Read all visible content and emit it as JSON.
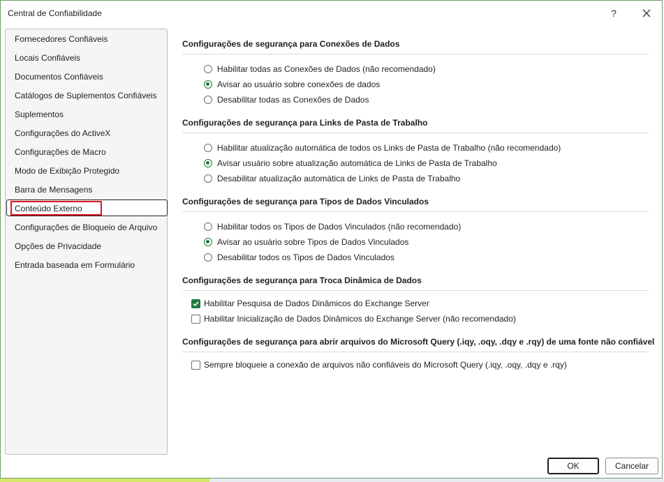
{
  "window": {
    "title": "Central de Confiabilidade",
    "help_glyph": "?",
    "close_icon": "close-icon"
  },
  "sidebar": {
    "items": [
      {
        "label": "Fornecedores Confiáveis"
      },
      {
        "label": "Locais Confiáveis"
      },
      {
        "label": "Documentos Confiáveis"
      },
      {
        "label": "Catálogos de Suplementos Confiáveis"
      },
      {
        "label": "Suplementos"
      },
      {
        "label": "Configurações do ActiveX"
      },
      {
        "label": "Configurações de Macro"
      },
      {
        "label": "Modo de Exibição Protegido"
      },
      {
        "label": "Barra de Mensagens"
      },
      {
        "label": "Conteúdo Externo",
        "selected": true
      },
      {
        "label": "Configurações de Bloqueio de Arquivo"
      },
      {
        "label": "Opções de Privacidade"
      },
      {
        "label": "Entrada baseada em Formulário"
      }
    ]
  },
  "sections": [
    {
      "title": "Configurações de segurança para Conexões de Dados",
      "radios": [
        {
          "label": "Habilitar todas as Conexões de Dados (não recomendado)",
          "checked": false
        },
        {
          "label": "Avisar ao usuário sobre conexões de dados",
          "checked": true
        },
        {
          "label": "Desabilitar todas as Conexões de Dados",
          "checked": false
        }
      ]
    },
    {
      "title": "Configurações de segurança para Links de Pasta de Trabalho",
      "radios": [
        {
          "label": "Habilitar atualização automática de todos os Links de Pasta de Trabalho (não recomendado)",
          "checked": false
        },
        {
          "label": "Avisar usuário sobre atualização automática de Links de Pasta de Trabalho",
          "checked": true
        },
        {
          "label": "Desabilitar atualização automática de Links de Pasta de Trabalho",
          "checked": false
        }
      ]
    },
    {
      "title": "Configurações de segurança para Tipos de Dados Vinculados",
      "radios": [
        {
          "label": "Habilitar todos os Tipos de Dados Vinculados (não recomendado)",
          "checked": false
        },
        {
          "label": "Avisar ao usuário sobre Tipos de Dados Vinculados",
          "checked": true
        },
        {
          "label": "Desabilitar todos os Tipos de Dados Vinculados",
          "checked": false
        }
      ]
    },
    {
      "title": "Configurações de segurança para Troca Dinâmica de Dados",
      "checks": [
        {
          "label": "Habilitar Pesquisa de Dados Dinâmicos do Exchange Server",
          "checked": true
        },
        {
          "label": "Habilitar Inicialização de Dados Dinâmicos do Exchange Server (não recomendado)",
          "checked": false
        }
      ]
    },
    {
      "title": "Configurações de segurança para abrir arquivos do Microsoft Query (.iqy, .oqy, .dqy e .rqy) de uma fonte não confiável",
      "checks": [
        {
          "label": "Sempre bloqueie a conexão de arquivos não confiáveis do Microsoft Query (.iqy, .oqy, .dqy e .rqy)",
          "checked": false
        }
      ]
    }
  ],
  "buttons": {
    "ok": "OK",
    "cancel": "Cancelar"
  },
  "colors": {
    "accent": "#1e7a3e",
    "highlight_box": "#e0151c"
  }
}
